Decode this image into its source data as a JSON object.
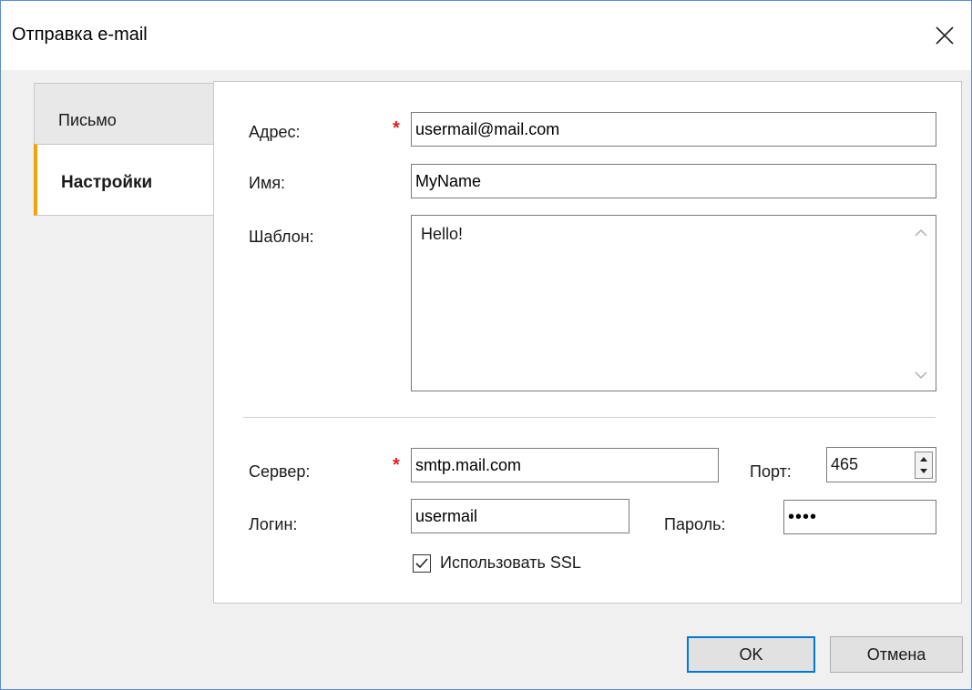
{
  "window": {
    "title": "Отправка e-mail"
  },
  "tabs": [
    {
      "label": "Письмо"
    },
    {
      "label": "Настройки"
    }
  ],
  "form": {
    "address": {
      "label": "Адрес:",
      "value": "usermail@mail.com",
      "required_mark": "*"
    },
    "name": {
      "label": "Имя:",
      "value": "MyName"
    },
    "template": {
      "label": "Шаблон:",
      "value": "Hello!"
    },
    "server": {
      "label": "Сервер:",
      "value": "smtp.mail.com",
      "required_mark": "*"
    },
    "port": {
      "label": "Порт:",
      "value": "465"
    },
    "login": {
      "label": "Логин:",
      "value": "usermail"
    },
    "password": {
      "label": "Пароль:",
      "value": "••••"
    },
    "use_ssl": {
      "label": "Использовать SSL",
      "checked": true
    }
  },
  "buttons": {
    "ok": "OK",
    "cancel": "Отмена"
  },
  "colors": {
    "active_tab_accent": "#f0a30a",
    "required": "#e02020",
    "default_button_border": "#0078d7",
    "window_border": "#5b8fd0"
  },
  "icons": [
    "close-icon",
    "scroll-up-icon",
    "scroll-down-icon",
    "spin-up-icon",
    "spin-down-icon",
    "checkmark-icon"
  ]
}
